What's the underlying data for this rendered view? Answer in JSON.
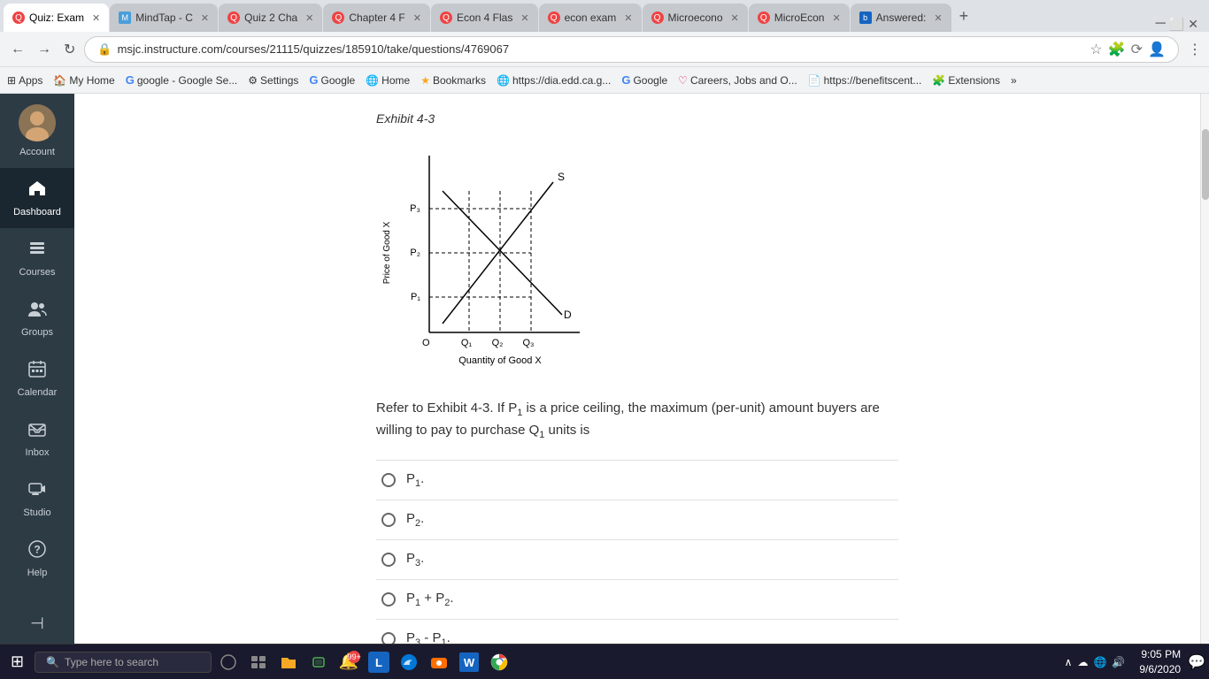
{
  "browser": {
    "tabs": [
      {
        "id": "tab1",
        "title": "Quiz: Exam",
        "active": true,
        "favicon_color": "#e44"
      },
      {
        "id": "tab2",
        "title": "MindTap - C",
        "active": false,
        "favicon_color": "#4a9eda"
      },
      {
        "id": "tab3",
        "title": "Quiz 2 Cha",
        "active": false,
        "favicon_color": "#e44"
      },
      {
        "id": "tab4",
        "title": "Chapter 4 F",
        "active": false,
        "favicon_color": "#e44"
      },
      {
        "id": "tab5",
        "title": "Econ 4 Flas",
        "active": false,
        "favicon_color": "#e44"
      },
      {
        "id": "tab6",
        "title": "econ exam",
        "active": false,
        "favicon_color": "#e44"
      },
      {
        "id": "tab7",
        "title": "Microecono",
        "active": false,
        "favicon_color": "#e44"
      },
      {
        "id": "tab8",
        "title": "MicroEcon",
        "active": false,
        "favicon_color": "#e44"
      },
      {
        "id": "tab9",
        "title": "Answered:",
        "active": false,
        "favicon_color": "#1565c0"
      }
    ],
    "address": "msjc.instructure.com/courses/21115/quizzes/185910/take/questions/4769067",
    "bookmarks": [
      {
        "label": "Apps",
        "icon": "⊞"
      },
      {
        "label": "My Home",
        "icon": "🏠"
      },
      {
        "label": "google - Google Se...",
        "icon": "G"
      },
      {
        "label": "Settings",
        "icon": "⚙"
      },
      {
        "label": "Google",
        "icon": "G"
      },
      {
        "label": "Home",
        "icon": "🌐"
      },
      {
        "label": "Bookmarks",
        "icon": "★"
      },
      {
        "label": "https://dia.edd.ca.g...",
        "icon": "🌐"
      },
      {
        "label": "Google",
        "icon": "G"
      },
      {
        "label": "Careers, Jobs and O...",
        "icon": "♡"
      },
      {
        "label": "https://benefitscent...",
        "icon": "📄"
      },
      {
        "label": "Extensions",
        "icon": "🧩"
      },
      {
        "label": "»",
        "icon": ""
      }
    ]
  },
  "sidebar": {
    "items": [
      {
        "id": "account",
        "label": "Account",
        "icon": "👤",
        "active": false
      },
      {
        "id": "dashboard",
        "label": "Dashboard",
        "icon": "🏠",
        "active": true
      },
      {
        "id": "courses",
        "label": "Courses",
        "icon": "📄",
        "active": false
      },
      {
        "id": "groups",
        "label": "Groups",
        "icon": "👥",
        "active": false
      },
      {
        "id": "calendar",
        "label": "Calendar",
        "icon": "📅",
        "active": false
      },
      {
        "id": "inbox",
        "label": "Inbox",
        "icon": "📥",
        "active": false
      },
      {
        "id": "studio",
        "label": "Studio",
        "icon": "📺",
        "active": false
      },
      {
        "id": "help",
        "label": "Help",
        "icon": "?",
        "active": false
      }
    ],
    "collapse_icon": "⊣"
  },
  "quiz": {
    "exhibit_title": "Exhibit 4-3",
    "question_text_part1": "Refer to Exhibit 4-3. If P",
    "question_sub1": "1",
    "question_text_part2": " is a price ceiling, the maximum (per-unit) amount buyers are willing to pay to purchase Q",
    "question_sub2": "1",
    "question_text_part3": " units is",
    "answers": [
      {
        "id": "a1",
        "label_text": "P",
        "label_sub": "1",
        "label_suffix": "."
      },
      {
        "id": "a2",
        "label_text": "P",
        "label_sub": "2",
        "label_suffix": "."
      },
      {
        "id": "a3",
        "label_text": "P",
        "label_sub": "3",
        "label_suffix": "."
      },
      {
        "id": "a4",
        "label_text": "P",
        "label_sub": "1",
        "label_suffix": " + P",
        "extra_sub": "2",
        "extra_suffix": "."
      },
      {
        "id": "a5",
        "label_text": "P",
        "label_sub": "3",
        "label_suffix": " - P",
        "extra_sub": "1",
        "extra_suffix": "."
      }
    ]
  },
  "taskbar": {
    "search_placeholder": "Type here to search",
    "time": "9:05 PM",
    "date": "9/6/2020"
  }
}
